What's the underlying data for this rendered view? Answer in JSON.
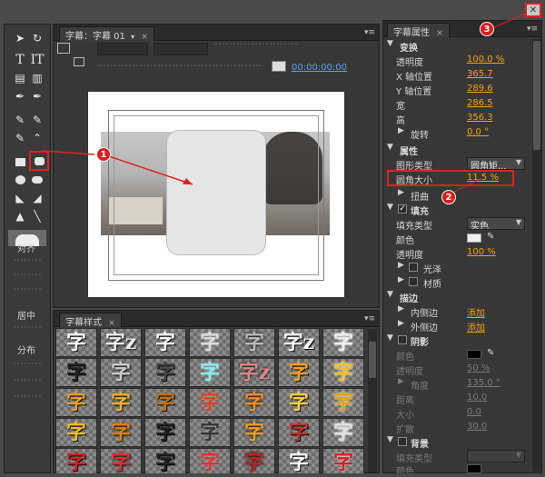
{
  "tools_panel": {
    "align_label": "对齐",
    "center_label": "居中",
    "distribute_label": "分布"
  },
  "editor": {
    "tab_label": "字幕：字幕 01",
    "timecode": "00:00:00:00"
  },
  "styles_panel": {
    "tab_label": "字幕样式",
    "glyph": "字",
    "glyph_alt": "z"
  },
  "properties": {
    "tab_label": "字幕属性",
    "transform": {
      "header": "变换",
      "opacity_label": "透明度",
      "opacity_value": "100.0 %",
      "x_label": "X 轴位置",
      "x_value": "365.7",
      "y_label": "Y 轴位置",
      "y_value": "289.6",
      "width_label": "宽",
      "width_value": "286.5",
      "height_label": "高",
      "height_value": "356.3",
      "rotation_label": "旋转",
      "rotation_value": "0.0 °"
    },
    "attributes": {
      "header": "属性",
      "shape_type_label": "图形类型",
      "shape_type_value": "圆角矩...",
      "corner_label": "圆角大小",
      "corner_value": "11.5 %",
      "distort_label": "扭曲"
    },
    "fill": {
      "header": "填充",
      "fill_type_label": "填充类型",
      "fill_type_value": "实色",
      "color_label": "颜色",
      "opacity_label": "透明度",
      "opacity_value": "100 %",
      "sheen_label": "光泽",
      "texture_label": "材质"
    },
    "stroke": {
      "header": "描边",
      "inner_label": "内侧边",
      "inner_value": "添加",
      "outer_label": "外侧边",
      "outer_value": "添加"
    },
    "shadow": {
      "header": "阴影",
      "color_label": "颜色",
      "opacity_label": "透明度",
      "opacity_value": "50 %",
      "angle_label": "角度",
      "angle_value": "135.0 °",
      "distance_label": "距离",
      "distance_value": "10.0",
      "size_label": "大小",
      "size_value": "0.0",
      "spread_label": "扩散",
      "spread_value": "30.0"
    },
    "background": {
      "header": "背景",
      "fill_type_label": "填充类型",
      "color_label": "颜色"
    }
  },
  "callouts": {
    "one": "1",
    "two": "2",
    "three": "3"
  },
  "colors": {
    "accent_value": "#f2a20f",
    "highlight_red": "#e02020"
  }
}
